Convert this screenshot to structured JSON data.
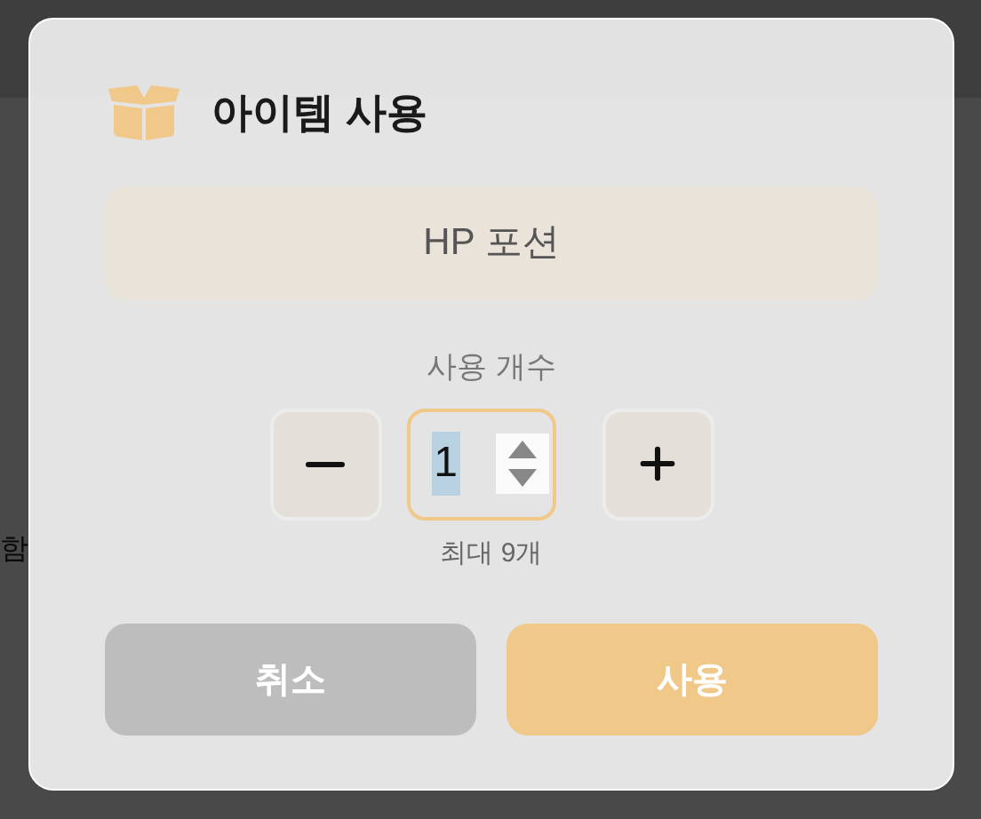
{
  "background": {
    "side_text": "함"
  },
  "dialog": {
    "title": "아이템 사용",
    "item_name": "HP 포션",
    "quantity_label": "사용 개수",
    "quantity": "1",
    "max_note": "최대 9개",
    "buttons": [
      {
        "label": "취소",
        "kind": "cancel"
      },
      {
        "label": "사용",
        "kind": "primary"
      }
    ]
  }
}
